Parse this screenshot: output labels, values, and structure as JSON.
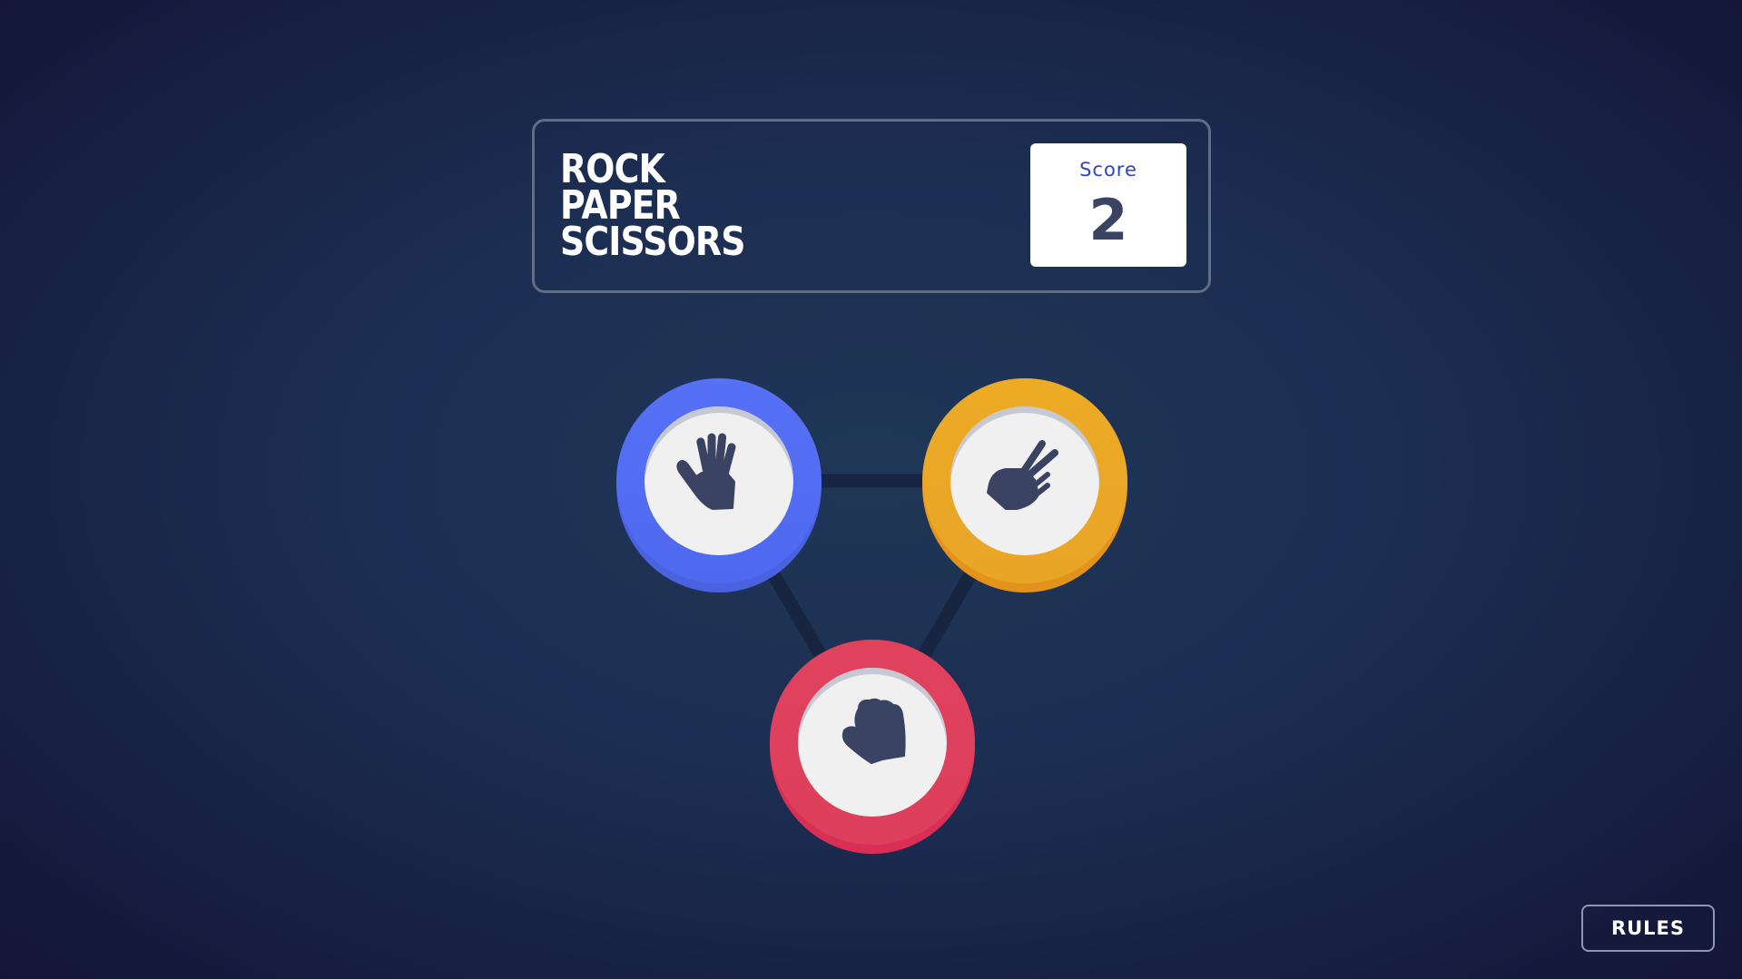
{
  "header": {
    "title_lines": [
      "ROCK",
      "PAPER",
      "SCISSORS"
    ],
    "score_label": "Score",
    "score_value": "2"
  },
  "choices": [
    {
      "name": "paper",
      "icon": "hand-paper-icon",
      "ring_color": "#5671f5"
    },
    {
      "name": "scissors",
      "icon": "hand-scissors-icon",
      "ring_color": "#ecaa25"
    },
    {
      "name": "rock",
      "icon": "hand-rock-icon",
      "ring_color": "#e0425e"
    }
  ],
  "footer": {
    "rules_label": "RULES"
  },
  "colors": {
    "background_center": "#1f3757",
    "background_edge": "#131537",
    "header_border": "#606e85",
    "score_label": "#2a46c0",
    "score_value": "#3b4363",
    "icon": "#3b4363"
  }
}
